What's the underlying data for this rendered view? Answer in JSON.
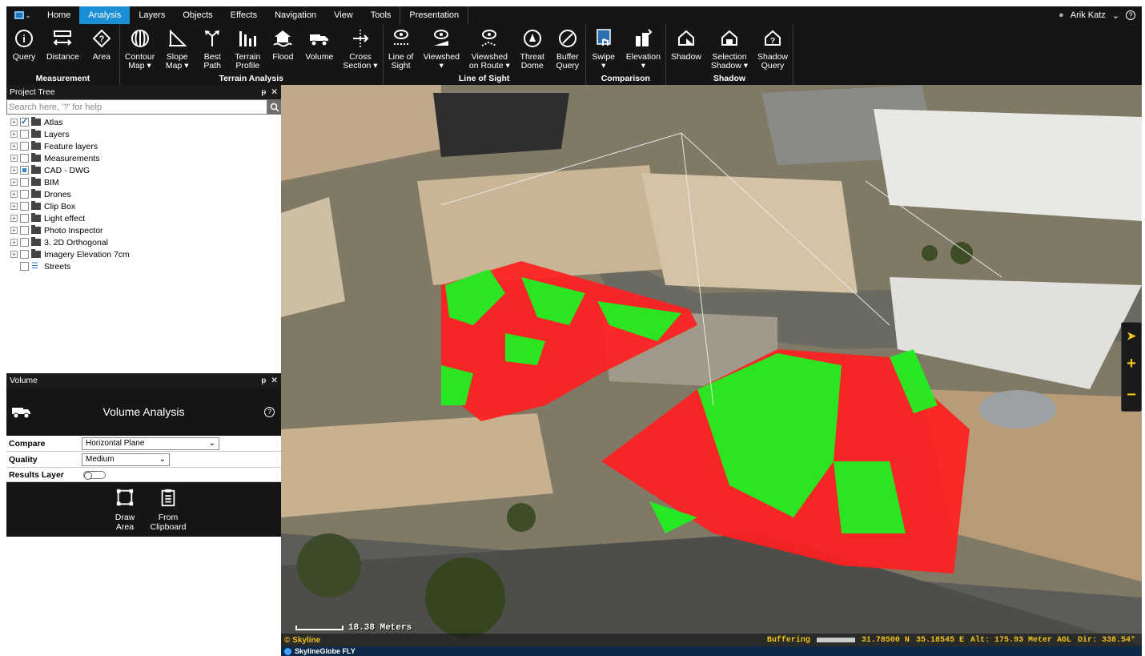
{
  "menubar": {
    "tabs": [
      "Home",
      "Analysis",
      "Layers",
      "Objects",
      "Effects",
      "Navigation",
      "View",
      "Tools",
      "Presentation"
    ],
    "active_tab": "Analysis",
    "user_name": "Arik Katz",
    "user_chevron": "⌄",
    "help_icon": "?"
  },
  "ribbon": {
    "groups": [
      {
        "label": "Measurement",
        "buttons": [
          {
            "label": "Query",
            "sub": "",
            "icon": "query-icon"
          },
          {
            "label": "Distance",
            "sub": "",
            "icon": "distance-icon"
          },
          {
            "label": "Area",
            "sub": "",
            "icon": "area-icon"
          }
        ]
      },
      {
        "label": "Terrain Analysis",
        "buttons": [
          {
            "label": "Contour",
            "sub": "Map ▾",
            "icon": "contour-map-icon"
          },
          {
            "label": "Slope",
            "sub": "Map ▾",
            "icon": "slope-map-icon"
          },
          {
            "label": "Best",
            "sub": "Path",
            "icon": "best-path-icon"
          },
          {
            "label": "Terrain",
            "sub": "Profile",
            "icon": "terrain-profile-icon"
          },
          {
            "label": "Flood",
            "sub": "",
            "icon": "flood-icon"
          },
          {
            "label": "Volume",
            "sub": "",
            "icon": "volume-icon"
          },
          {
            "label": "Cross",
            "sub": "Section ▾",
            "icon": "cross-section-icon"
          }
        ]
      },
      {
        "label": "Line of Sight",
        "buttons": [
          {
            "label": "Line of",
            "sub": "Sight",
            "icon": "line-of-sight-icon"
          },
          {
            "label": "Viewshed",
            "sub": "▾",
            "icon": "viewshed-icon"
          },
          {
            "label": "Viewshed",
            "sub": "on Route ▾",
            "icon": "viewshed-route-icon"
          },
          {
            "label": "Threat",
            "sub": "Dome",
            "icon": "threat-dome-icon"
          },
          {
            "label": "Buffer",
            "sub": "Query",
            "icon": "buffer-query-icon"
          }
        ]
      },
      {
        "label": "Comparison",
        "buttons": [
          {
            "label": "Swipe",
            "sub": "▾",
            "icon": "swipe-icon"
          },
          {
            "label": "Elevation",
            "sub": "▾",
            "icon": "elevation-icon"
          }
        ]
      },
      {
        "label": "Shadow",
        "buttons": [
          {
            "label": "Shadow",
            "sub": "",
            "icon": "shadow-icon"
          },
          {
            "label": "Selection",
            "sub": "Shadow ▾",
            "icon": "selection-shadow-icon"
          },
          {
            "label": "Shadow",
            "sub": "Query",
            "icon": "shadow-query-icon"
          }
        ]
      }
    ]
  },
  "project_tree": {
    "title": "Project Tree",
    "pin": "ᵽ",
    "close": "✕",
    "search_placeholder": "Search here, '?' for help",
    "items": [
      {
        "label": "Atlas",
        "state": "checked",
        "type": "folder"
      },
      {
        "label": "Layers",
        "state": "unchecked",
        "type": "folder"
      },
      {
        "label": "Feature layers",
        "state": "unchecked",
        "type": "folder"
      },
      {
        "label": "Measurements",
        "state": "unchecked",
        "type": "folder"
      },
      {
        "label": "CAD - DWG",
        "state": "partial",
        "type": "folder"
      },
      {
        "label": "BIM",
        "state": "unchecked",
        "type": "folder"
      },
      {
        "label": "Drones",
        "state": "unchecked",
        "type": "folder"
      },
      {
        "label": "Clip Box",
        "state": "unchecked",
        "type": "folder"
      },
      {
        "label": "Light effect",
        "state": "unchecked",
        "type": "folder"
      },
      {
        "label": "Photo Inspector",
        "state": "unchecked",
        "type": "folder"
      },
      {
        "label": "3. 2D Orthogonal",
        "state": "unchecked",
        "type": "folder"
      },
      {
        "label": "Imagery Elevation 7cm",
        "state": "unchecked",
        "type": "folder"
      },
      {
        "label": "Streets",
        "state": "unchecked",
        "type": "layer"
      }
    ]
  },
  "volume_panel": {
    "title": "Volume",
    "heading": "Volume Analysis",
    "help": "?",
    "compare_label": "Compare",
    "compare_value": "Horizontal Plane",
    "quality_label": "Quality",
    "quality_value": "Medium",
    "results_label": "Results Layer",
    "results_on": false,
    "tools": [
      {
        "label1": "Draw",
        "label2": "Area",
        "icon": "draw-area-icon"
      },
      {
        "label1": "From",
        "label2": "Clipboard",
        "icon": "clipboard-icon"
      }
    ]
  },
  "map": {
    "scale_text": "18.38 Meters",
    "brand": "© Skyline",
    "buffering_label": "Buffering",
    "lat": "31.78500 N",
    "lon": "35.18545 E",
    "alt": "Alt: 175.93 Meter AGL",
    "dir": "Dir: 338.54°",
    "taskbar_app": "SkylineGlobe FLY"
  },
  "colors": {
    "accent": "#1b8fd6",
    "cut": "#ff2020",
    "fill": "#22ee22",
    "status_text": "#f0c419"
  }
}
